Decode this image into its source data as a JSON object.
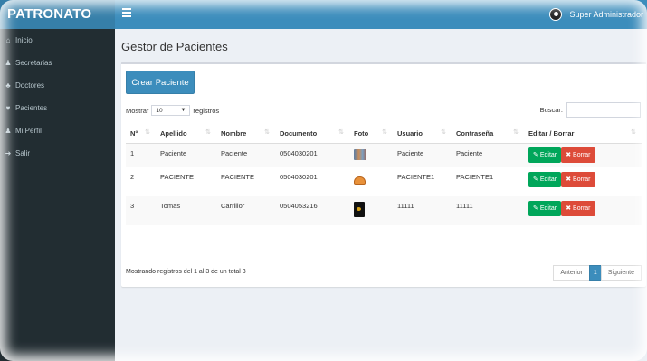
{
  "app": {
    "logo": "PATRONATO"
  },
  "header": {
    "user_name": "Super Administrador"
  },
  "sidebar": {
    "items": [
      {
        "icon": "home-icon",
        "glyph": "⌂",
        "label": "Inicio"
      },
      {
        "icon": "user-icon",
        "glyph": "♟",
        "label": "Secretarias"
      },
      {
        "icon": "doctor-icon",
        "glyph": "♣",
        "label": "Doctores"
      },
      {
        "icon": "users-icon",
        "glyph": "♥",
        "label": "Pacientes"
      },
      {
        "icon": "profile-icon",
        "glyph": "♟",
        "label": "Mi Perfil"
      },
      {
        "icon": "sign-out-icon",
        "glyph": "➜",
        "label": "Salir"
      }
    ]
  },
  "main": {
    "title": "Gestor de Pacientes",
    "create_button": "Crear Paciente",
    "length": {
      "prefix": "Mostrar",
      "value": "10",
      "suffix": "registros"
    },
    "search": {
      "label": "Buscar:",
      "placeholder": ""
    },
    "table": {
      "headers": [
        "N°",
        "Apellido",
        "Nombre",
        "Documento",
        "Foto",
        "Usuario",
        "Contraseña",
        "Editar / Borrar"
      ],
      "rows": [
        [
          "1",
          "Paciente",
          "Paciente",
          "0504030201",
          "",
          "Paciente",
          "Paciente"
        ],
        [
          "2",
          "PACIENTE",
          "PACIENTE",
          "0504030201",
          "",
          "PACIENTE1",
          "PACIENTE1"
        ],
        [
          "3",
          "Tomas",
          "Carrillor",
          "0504053216",
          "",
          "11111",
          "11111"
        ]
      ],
      "edit_label": "Editar",
      "delete_label": "Borrar"
    },
    "info": "Mostrando registros del 1 al 3 de un total 3",
    "pagination": {
      "prev": "Anterior",
      "current": "1",
      "next": "Siguiente"
    }
  },
  "colors": {
    "primary": "#3c8dbc",
    "logo_bg": "#367fa9",
    "sidebar_bg": "#222d32",
    "success": "#00a65a",
    "danger": "#dd4b39",
    "content_bg": "#ecf0f5"
  }
}
